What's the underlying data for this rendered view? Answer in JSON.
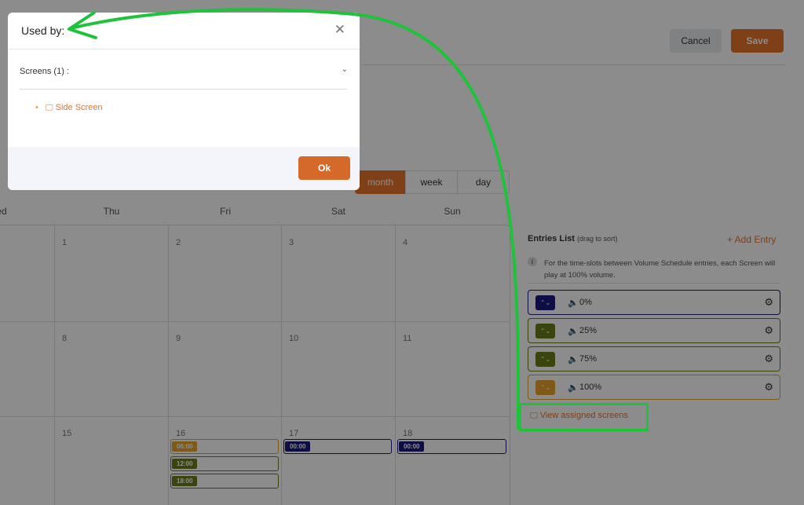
{
  "header": {
    "cancel_label": "Cancel",
    "save_label": "Save"
  },
  "views": {
    "month": "month",
    "week": "week",
    "day": "day",
    "active": "month"
  },
  "calendar": {
    "days_of_week": [
      "ed",
      "Thu",
      "Fri",
      "Sat",
      "Sun"
    ],
    "weeks": [
      [
        "",
        "1",
        "2",
        "3",
        "4"
      ],
      [
        "",
        "8",
        "9",
        "10",
        "11"
      ],
      [
        "",
        "15",
        "16",
        "17",
        "18"
      ]
    ],
    "events": [
      {
        "day": "16",
        "time": "06:00",
        "color": "#e8a22a"
      },
      {
        "day": "16",
        "time": "12:00",
        "color": "#6b7d1c"
      },
      {
        "day": "16",
        "time": "18:00",
        "color": "#6b7d1c"
      },
      {
        "day": "17",
        "time": "00:00",
        "color": "#1b1a7e"
      },
      {
        "day": "18",
        "time": "00:00",
        "color": "#1b1a7e"
      }
    ]
  },
  "entries": {
    "title": "Entries List",
    "subtitle": "(drag to sort)",
    "add_label": "+ Add Entry",
    "info_text": "For the time-slots between Volume Schedule entries, each Screen will play at 100% volume.",
    "items": [
      {
        "volume": "0%",
        "color": "#1b1a7e"
      },
      {
        "volume": "25%",
        "color": "#6b7d1c"
      },
      {
        "volume": "75%",
        "color": "#6b7d1c"
      },
      {
        "volume": "100%",
        "color": "#e8a22a"
      }
    ],
    "view_assigned_label": "View assigned screens"
  },
  "modal": {
    "title": "Used by:",
    "section_title": "Screens (1) :",
    "screens": [
      "Side Screen"
    ],
    "ok_label": "Ok"
  },
  "colors": {
    "accent": "#e8742a",
    "annotation": "#1fc23a"
  }
}
